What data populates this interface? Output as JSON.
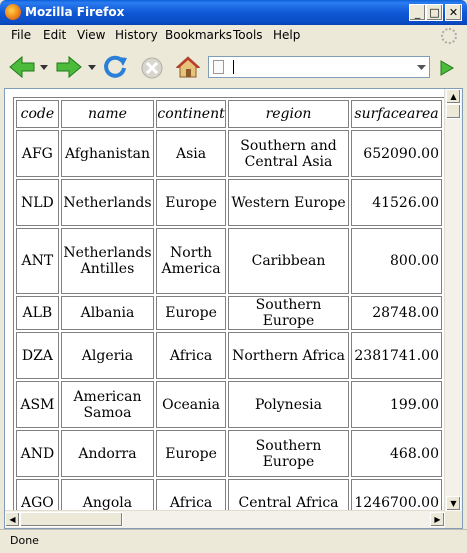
{
  "window": {
    "title": "Mozilla Firefox"
  },
  "menu": [
    {
      "label": "File"
    },
    {
      "label": "Edit"
    },
    {
      "label": "View"
    },
    {
      "label": "History"
    },
    {
      "label": "Bookmarks"
    },
    {
      "label": "Tools"
    },
    {
      "label": "Help"
    }
  ],
  "urlbar": {
    "value": ""
  },
  "table": {
    "headers": [
      "code",
      "name",
      "continent",
      "region",
      "surfacearea"
    ],
    "rows": [
      [
        "AFG",
        "Afghanistan",
        "Asia",
        "Southern and Central Asia",
        "652090.00"
      ],
      [
        "NLD",
        "Netherlands",
        "Europe",
        "Western Europe",
        "41526.00"
      ],
      [
        "ANT",
        "Netherlands Antilles",
        "North America",
        "Caribbean",
        "800.00"
      ],
      [
        "ALB",
        "Albania",
        "Europe",
        "Southern Europe",
        "28748.00"
      ],
      [
        "DZA",
        "Algeria",
        "Africa",
        "Northern Africa",
        "2381741.00"
      ],
      [
        "ASM",
        "American Samoa",
        "Oceania",
        "Polynesia",
        "199.00"
      ],
      [
        "AND",
        "Andorra",
        "Europe",
        "Southern Europe",
        "468.00"
      ],
      [
        "AGO",
        "Angola",
        "Africa",
        "Central Africa",
        "1246700.00"
      ]
    ]
  },
  "status": {
    "text": "Done"
  },
  "colors": {
    "titlebar": "#0a4cc4",
    "chrome": "#ece9d8",
    "arrow_green": "#2aa12a",
    "reload_blue": "#2a7fd8"
  }
}
